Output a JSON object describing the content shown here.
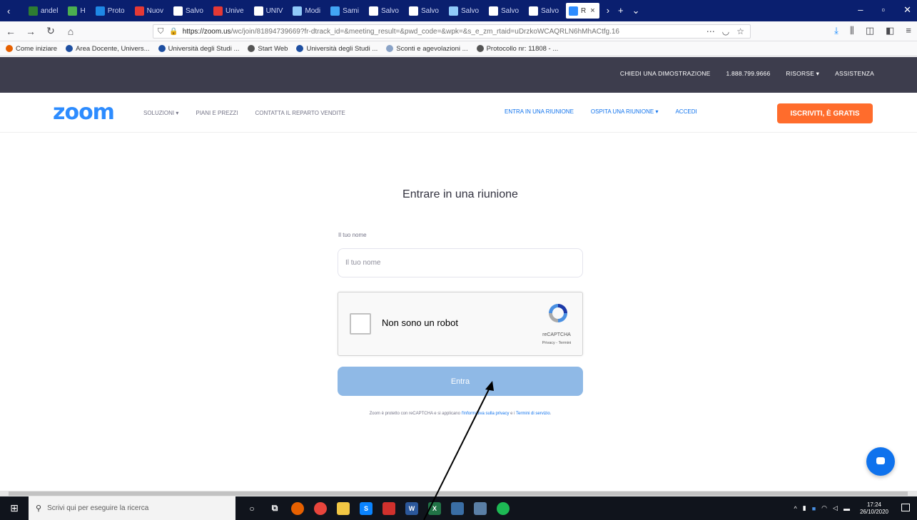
{
  "browser": {
    "tabs": [
      {
        "label": "andel",
        "fav": "#2e7d32"
      },
      {
        "label": "H",
        "fav": "#4caf50"
      },
      {
        "label": "Proto",
        "fav": "#1e88e5"
      },
      {
        "label": "Nuov",
        "fav": "#e53935"
      },
      {
        "label": "Salvo",
        "fav": "#ffffff"
      },
      {
        "label": "Unive",
        "fav": "#e53935"
      },
      {
        "label": "UNIV",
        "fav": "#ffffff"
      },
      {
        "label": "Modi",
        "fav": "#90caf9"
      },
      {
        "label": "Sami",
        "fav": "#42a5f5"
      },
      {
        "label": "Salvo",
        "fav": "#ffffff"
      },
      {
        "label": "Salvo",
        "fav": "#ffffff"
      },
      {
        "label": "Salvo",
        "fav": "#90caf9"
      },
      {
        "label": "Salvo",
        "fav": "#ffffff"
      },
      {
        "label": "Salvo",
        "fav": "#ffffff"
      }
    ],
    "active_tab": {
      "label": "R",
      "close": "×"
    },
    "url_host": "https://zoom.us",
    "url_rest": "/wc/join/81894739669?fr-dtrack_id=&meeting_result=&pwd_code=&wpk=&s_e_zm_rtaid=uDrzkoWCAQRLN6hMhACtfg.16"
  },
  "bookmarks": [
    {
      "label": "Come iniziare",
      "color": "#e66000"
    },
    {
      "label": "Area Docente, Univers...",
      "color": "#1e4fa1"
    },
    {
      "label": "Università degli Studi ...",
      "color": "#1e4fa1"
    },
    {
      "label": "Start Web",
      "color": "#555555"
    },
    {
      "label": "Università degli Studi ...",
      "color": "#1e4fa1"
    },
    {
      "label": "Sconti e agevolazioni ...",
      "color": "#8aa3c7"
    },
    {
      "label": "Protocollo nr: 11808 - ...",
      "color": "#555555"
    }
  ],
  "zoom_top": {
    "demo": "CHIEDI UNA DIMOSTRAZIONE",
    "phone": "1.888.799.9666",
    "resources": "RISORSE ▾",
    "support": "ASSISTENZA"
  },
  "zoom_nav": {
    "logo": "zoom",
    "solutions": "SOLUZIONI ▾",
    "plans": "PIANI E PREZZI",
    "contact": "CONTATTA IL REPARTO VENDITE",
    "join": "ENTRA IN UNA RIUNIONE",
    "host": "OSPITA UNA RIUNIONE ▾",
    "signin": "ACCEDI",
    "signup": "ISCRIVITI, È GRATIS"
  },
  "join_form": {
    "title": "Entrare in una riunione",
    "name_label": "Il tuo nome",
    "name_placeholder": "Il tuo nome",
    "captcha_label": "Non sono un robot",
    "captcha_brand": "reCAPTCHA",
    "captcha_sub": "Privacy - Termini",
    "join_button": "Entra",
    "notice_prefix": "Zoom è protetto con reCAPTCHA e si applicano ",
    "privacy_link": "l'Informativa sulla privacy",
    "notice_mid": " e i ",
    "terms_link": "Termini di servizio",
    "notice_end": "."
  },
  "taskbar": {
    "search_placeholder": "Scrivi qui per eseguire la ricerca",
    "time": "17:24",
    "date": "26/10/2020"
  }
}
